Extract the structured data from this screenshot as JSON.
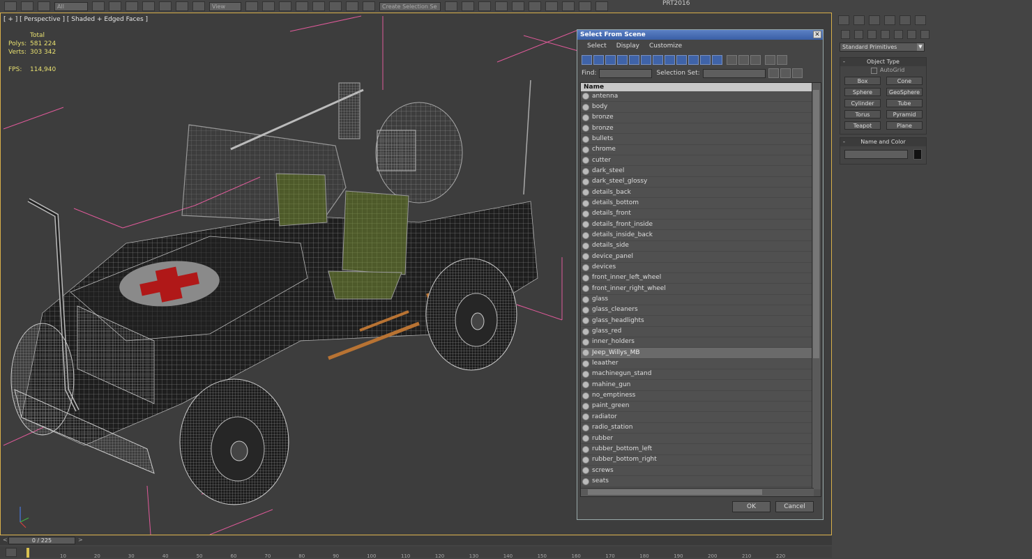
{
  "toolbar": {
    "filter_label": "All",
    "view_label": "View",
    "selection_set_placeholder": "Create Selection Se",
    "workspace_label": "PRT2016"
  },
  "viewport": {
    "label": "[ + ] [ Perspective ] [ Shaded + Edged Faces ]",
    "stats": {
      "total_label": "Total",
      "polys_label": "Polys:",
      "polys_value": "581 224",
      "verts_label": "Verts:",
      "verts_value": "303 342",
      "fps_label": "FPS:",
      "fps_value": "114,940"
    }
  },
  "dialog": {
    "title": "Select From Scene",
    "close": "✕",
    "menu": [
      "Select",
      "Display",
      "Customize"
    ],
    "find_label": "Find:",
    "selection_set_label": "Selection Set:",
    "column_header": "Name",
    "items": [
      "antenna",
      "body",
      "bronze",
      "bronze",
      "bullets",
      "chrome",
      "cutter",
      "dark_steel",
      "dark_steel_glossy",
      "details_back",
      "details_bottom",
      "details_front",
      "details_front_inside",
      "details_inside_back",
      "details_side",
      "device_panel",
      "devices",
      "front_inner_left_wheel",
      "front_inner_right_wheel",
      "glass",
      "glass_cleaners",
      "glass_headlights",
      "glass_red",
      "inner_holders",
      "Jeep_Willys_MB",
      "leaather",
      "machinegun_stand",
      "mahine_gun",
      "no_emptiness",
      "paint_green",
      "radiator",
      "radio_station",
      "rubber",
      "rubber_bottom_left",
      "rubber_bottom_right",
      "screws",
      "seats"
    ],
    "selected_item": "Jeep_Willys_MB",
    "ok_label": "OK",
    "cancel_label": "Cancel"
  },
  "command_panel": {
    "category_dropdown": "Standard Primitives",
    "object_type_title": "Object Type",
    "autogrid_label": "AutoGrid",
    "object_buttons": [
      "Box",
      "Cone",
      "Sphere",
      "GeoSphere",
      "Cylinder",
      "Tube",
      "Torus",
      "Pyramid",
      "Teapot",
      "Plane"
    ],
    "name_color_title": "Name and Color",
    "rollout_minus": "-"
  },
  "timeline": {
    "frame_display": "0 / 225",
    "prev_label": "<",
    "next_label": ">",
    "ticks": [
      "10",
      "20",
      "30",
      "40",
      "50",
      "60",
      "70",
      "80",
      "90",
      "100",
      "110",
      "120",
      "130",
      "140",
      "150",
      "160",
      "170",
      "180",
      "190",
      "200",
      "210",
      "220"
    ]
  },
  "colors": {
    "viewport_border": "#d9b04a",
    "stats_text": "#e8e070",
    "seat_green": "#5a6b2e",
    "cross_red": "#b01818",
    "wire": "#b0b0b0",
    "bbox_pink": "#e05a9a"
  }
}
